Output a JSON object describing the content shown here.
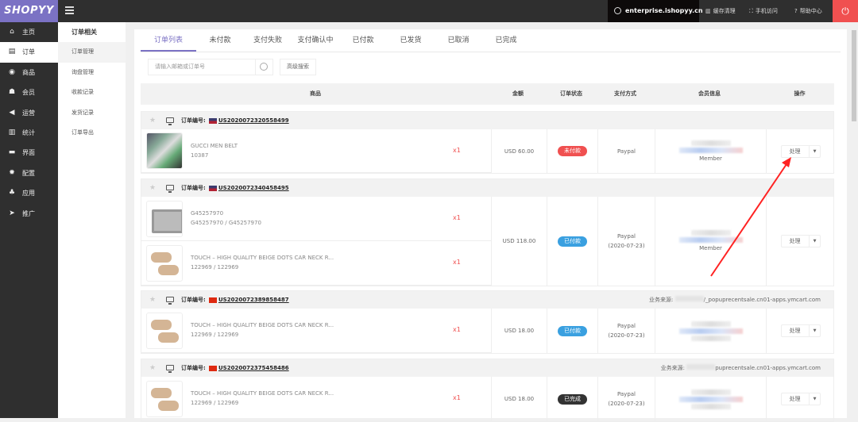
{
  "app": {
    "logo": "SHOPYY",
    "domain": "enterprise.ishopyy.cn",
    "cache": "缓存清理",
    "mobile": "手机访问",
    "help": "帮助中心"
  },
  "sidebar": {
    "items": [
      {
        "label": "主页",
        "icon": "home-icon"
      },
      {
        "label": "订单",
        "icon": "order-icon"
      },
      {
        "label": "商品",
        "icon": "product-icon"
      },
      {
        "label": "会员",
        "icon": "member-icon"
      },
      {
        "label": "运营",
        "icon": "megaphone-icon"
      },
      {
        "label": "统计",
        "icon": "chart-icon"
      },
      {
        "label": "界面",
        "icon": "layout-icon"
      },
      {
        "label": "配置",
        "icon": "gear-icon"
      },
      {
        "label": "应用",
        "icon": "app-icon"
      },
      {
        "label": "推广",
        "icon": "send-icon"
      }
    ]
  },
  "subnav": {
    "title": "订单相关",
    "items": [
      "订单管理",
      "询盘管理",
      "收款记录",
      "发货记录",
      "订单导出"
    ]
  },
  "tabs": [
    "订单列表",
    "未付款",
    "支付失败",
    "支付确认中",
    "已付款",
    "已发货",
    "已取消",
    "已完成"
  ],
  "search": {
    "placeholder": "请输入邮箱或订单号",
    "advanced": "高级搜索"
  },
  "columns": {
    "product": "商品",
    "amount": "金额",
    "status": "订单状态",
    "payment": "支付方式",
    "member": "会员信息",
    "action": "操作"
  },
  "order_label": "订单编号:",
  "source_label": "业务来源:",
  "action_label": "处理",
  "member_text": "Member",
  "orders": [
    {
      "number": "US2020072320558499",
      "flag": "us",
      "source": "",
      "amount": "USD 60.00",
      "status": "未付款",
      "status_color": "#f05050",
      "payment": "Paypal",
      "pay_date": "",
      "products": [
        {
          "name": "GUCCI MEN BELT",
          "sku": "10387",
          "qty": "x1",
          "thumb": "belt"
        }
      ]
    },
    {
      "number": "US2020072340458495",
      "flag": "us",
      "source": "",
      "amount": "USD 118.00",
      "status": "已付款",
      "status_color": "#3aa0e0",
      "payment": "Paypal",
      "pay_date": "(2020-07-23)",
      "products": [
        {
          "name": "G45257970",
          "sku": "G45257970 / G45257970",
          "qty": "x1",
          "thumb": "lamp"
        },
        {
          "name": "TOUCH – HIGH QUALITY BEIGE DOTS CAR NECK R...",
          "sku": "122969 / 122969",
          "qty": "x1",
          "thumb": "pillow"
        }
      ]
    },
    {
      "number": "US2020072389858487",
      "flag": "cn",
      "source": "/_popuprecentsale.cn01-apps.ymcart.com",
      "amount": "USD 18.00",
      "status": "已付款",
      "status_color": "#3aa0e0",
      "payment": "Paypal",
      "pay_date": "(2020-07-23)",
      "products": [
        {
          "name": "TOUCH – HIGH QUALITY BEIGE DOTS CAR NECK R...",
          "sku": "122969 / 122969",
          "qty": "x1",
          "thumb": "pillow"
        }
      ]
    },
    {
      "number": "US2020072375458486",
      "flag": "cn",
      "source": "puprecentsale.cn01-apps.ymcart.com",
      "amount": "USD 18.00",
      "status": "已完成",
      "status_color": "#333333",
      "payment": "Paypal",
      "pay_date": "(2020-07-23)",
      "products": [
        {
          "name": "TOUCH – HIGH QUALITY BEIGE DOTS CAR NECK R...",
          "sku": "122969 / 122969",
          "qty": "x1",
          "thumb": "pillow"
        }
      ]
    }
  ]
}
